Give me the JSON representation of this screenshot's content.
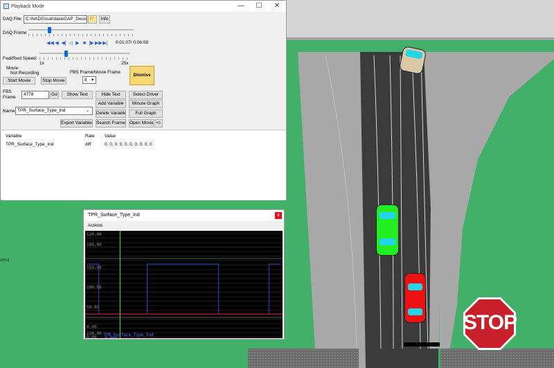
{
  "scene": {
    "stop_sign_text": "STOP",
    "side_label": "om.o",
    "colors": {
      "grass": "#43b06a",
      "road": "#3b3b3b",
      "shoulder": "#a8a8a8",
      "car_green": "#22ee22",
      "car_red": "#ee1111",
      "car_tan": "#d9c7a5",
      "windshield": "#22d6e8",
      "stop_red": "#c8202a"
    }
  },
  "playback": {
    "title": "Playback Mode",
    "window_controls": {
      "minimize": "—",
      "maximize": "☐",
      "close": "✕"
    },
    "daq_file_label": "DAQ File:",
    "daq_file_value": "C:\\NADS\\Isat\\data\\GAP_Decis",
    "info_button": "Info",
    "daq_frame_label": "DAQ Frame",
    "time_display": "0:01:07/ 0:06:08",
    "transport_icons": [
      "rewind-fast",
      "rewind",
      "step-back",
      "reverse-play",
      "play",
      "stop",
      "step-forward",
      "fast-forward",
      "end"
    ],
    "speed_label": "Fwd/Rwd Speed:",
    "speed_min": "1x",
    "speed_max": "25x",
    "movie_group_label": "Movie",
    "movie_status": "Not Recording",
    "start_movie": "Start Movie",
    "stop_movie": "Stop Movie",
    "fbs_ratio_label": "FBS Frame/Movie Frame",
    "fbs_ratio_value": "8",
    "dismiss": "Dismiss",
    "fbs_frame_label": "FBS Frame",
    "fbs_frame_value": "4778",
    "go_button": "Go",
    "show_text": "Show Text",
    "hide_text": "Hide Text",
    "select_driver": "Select Driver",
    "add_variable": "Add Variable",
    "minute_graph": "Minute Graph",
    "name_label": "Name:",
    "name_value": "TPR_Surface_Type_Ind",
    "delete_variable": "Delete Variable",
    "full_graph": "Full Graph",
    "export_variables": "Export Variables",
    "search_frames": "Search Frames",
    "open_movie": "Open Movie",
    "plus_minus": "+/-",
    "table_headers": [
      "Variable",
      "Rate",
      "Value"
    ],
    "table_rows": [
      {
        "variable": "TPR_Surface_Type_Ind",
        "rate": "diff",
        "value": "0, 0, 0, 0, 0, 0, 0, 0, 0, 0"
      }
    ]
  },
  "graph": {
    "title": "TPR_Surface_Type_Ind",
    "close": "x",
    "menu": "Actions",
    "series_label": "TPR_Surface_Type_Ind",
    "cursor_value": "0.000"
  },
  "chart_data": {
    "type": "line",
    "title": "TPR_Surface_Type_Ind",
    "y_ticks_top": [
      "120.00",
      "100.00",
      "80.00",
      "60.00",
      "40.00",
      "20.00",
      "0.00"
    ],
    "y_ticks_bottom": [
      "150.00",
      "100.00",
      "50.00",
      "0.00"
    ],
    "y_ticks_lowest": [
      "120.00",
      "0.00"
    ],
    "grid": true,
    "series": [
      {
        "name": "TPR_Surface_Type_Ind",
        "color": "#3344cc",
        "x": [
          0,
          0.06,
          0.06,
          0.31,
          0.31,
          0.68,
          0.68,
          0.94,
          0.94,
          1.0
        ],
        "values": [
          150,
          150,
          0,
          0,
          150,
          150,
          0,
          0,
          150,
          150
        ]
      }
    ],
    "ylim": [
      -20,
      170
    ],
    "cursor_x": 0.17
  }
}
